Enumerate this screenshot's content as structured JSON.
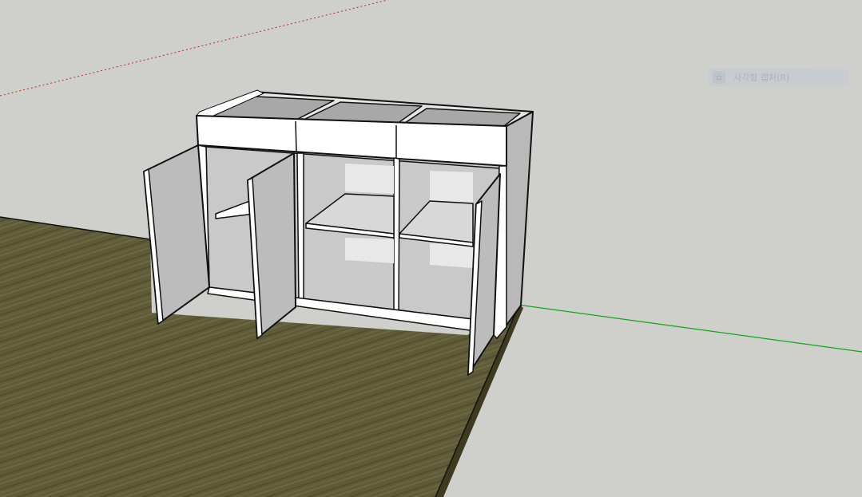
{
  "tooltip": {
    "label": "사각형 캡처(R)",
    "icon": "rectangle-capture-icon"
  },
  "colors": {
    "background": "#cfd0cb",
    "floor": "#5e5a36",
    "floor_edge": "#3e3a1f",
    "cabinet_white": "#ffffff",
    "panel_gray": "#bdbdbd",
    "outline": "#111111",
    "red_axis": "#c22424",
    "green_axis": "#11a51a"
  }
}
